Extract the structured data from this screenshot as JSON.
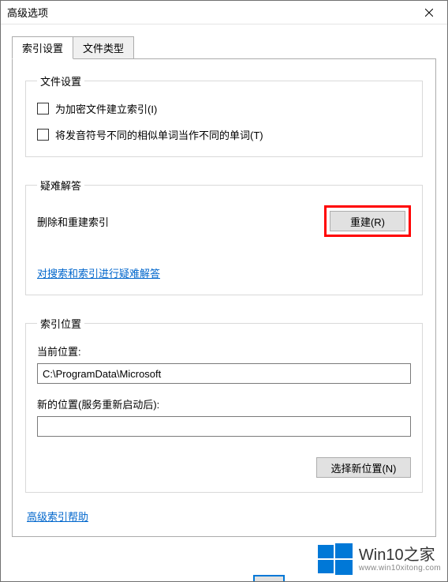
{
  "window": {
    "title": "高级选项"
  },
  "tabs": {
    "index_settings": "索引设置",
    "file_types": "文件类型"
  },
  "file_settings": {
    "legend": "文件设置",
    "opt_encrypted": "为加密文件建立索引(I)",
    "opt_diacritics": "将发音符号不同的相似单词当作不同的单词(T)"
  },
  "troubleshoot": {
    "legend": "疑难解答",
    "rebuild_label": "删除和重建索引",
    "rebuild_button": "重建(R)",
    "help_link": "对搜索和索引进行疑难解答"
  },
  "index_location": {
    "legend": "索引位置",
    "current_label": "当前位置:",
    "current_value": "C:\\ProgramData\\Microsoft",
    "new_label": "新的位置(服务重新启动后):",
    "new_value": "",
    "select_button": "选择新位置(N)"
  },
  "advanced_help": "高级索引帮助",
  "watermark": {
    "brand": "Win10之家",
    "url": "www.win10xitong.com"
  }
}
